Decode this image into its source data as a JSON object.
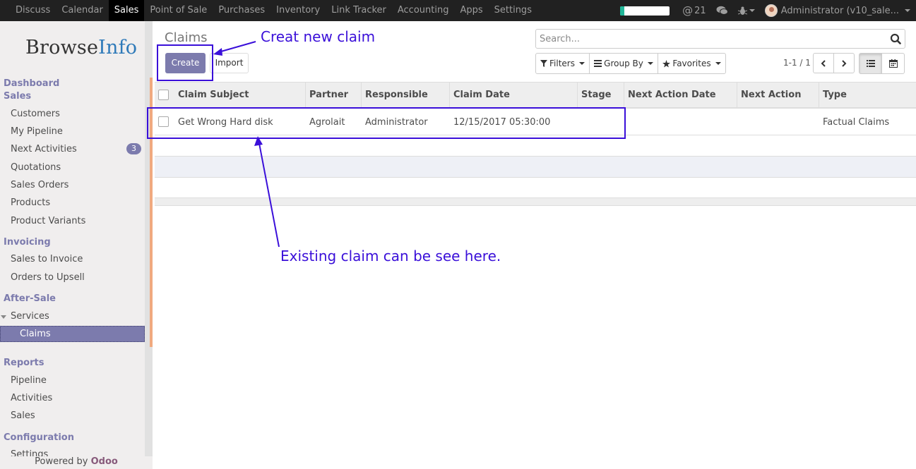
{
  "topbar": {
    "menu": [
      "Discuss",
      "Calendar",
      "Sales",
      "Point of Sale",
      "Purchases",
      "Inventory",
      "Link Tracker",
      "Accounting",
      "Apps",
      "Settings"
    ],
    "active_menu": "Sales",
    "progress_percent": 8,
    "progress_color": "#21b799",
    "mentions_count": "21",
    "user": "Administrator (v10_sale..."
  },
  "sidebar": {
    "logo_browse": "Browse",
    "logo_info": "Info",
    "dashboard": "Dashboard",
    "sales_title": "Sales",
    "sales_items": [
      "Customers",
      "My Pipeline",
      "Next Activities",
      "Quotations",
      "Sales Orders",
      "Products",
      "Product Variants"
    ],
    "next_activities_badge": "3",
    "invoicing_title": "Invoicing",
    "invoicing_items": [
      "Sales to Invoice",
      "Orders to Upsell"
    ],
    "aftersale_title": "After-Sale",
    "services": "Services",
    "claims": "Claims",
    "reports_title": "Reports",
    "reports_items": [
      "Pipeline",
      "Activities",
      "Sales"
    ],
    "configuration_title": "Configuration",
    "settings": "Settings",
    "powered_by": "Powered by",
    "odoo": "Odoo"
  },
  "control_panel": {
    "breadcrumb": "Claims",
    "create_label": "Create",
    "import_label": "Import",
    "search_placeholder": "Search...",
    "filters_label": "Filters",
    "groupby_label": "Group By",
    "favorites_label": "Favorites",
    "pager": "1-1 / 1"
  },
  "table": {
    "columns": [
      "Claim Subject",
      "Partner",
      "Responsible",
      "Claim Date",
      "Stage",
      "Next Action Date",
      "Next Action",
      "Type"
    ],
    "rows": [
      {
        "claim_subject": "Get Wrong Hard disk",
        "partner": "Agrolait",
        "responsible": "Administrator",
        "claim_date": "12/15/2017 05:30:00",
        "stage": "",
        "next_action_date": "",
        "next_action": "",
        "type": "Factual Claims"
      }
    ]
  },
  "annotations": {
    "create_note": "Creat new claim",
    "existing_note": "Existing claim can be see here.",
    "color": "#3a0fd9"
  }
}
